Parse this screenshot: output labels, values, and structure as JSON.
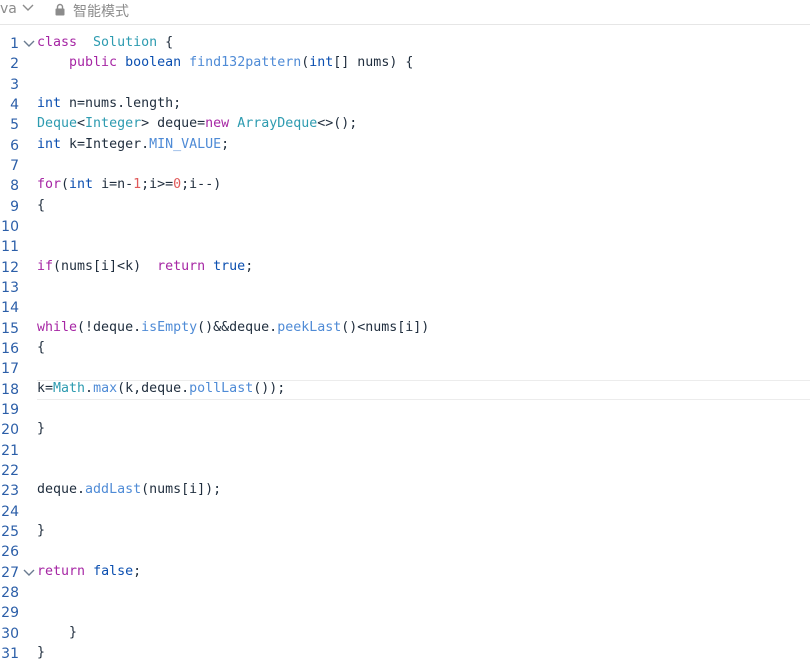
{
  "header": {
    "language": "va",
    "mode_label": "智能模式",
    "icons": [
      "chevron-down-icon",
      "lock-icon"
    ]
  },
  "editor": {
    "active_line": 18,
    "folded_lines": [
      1,
      27
    ],
    "lines": [
      {
        "n": "1",
        "tokens": [
          [
            "kw",
            "class"
          ],
          [
            "",
            "  "
          ],
          [
            "cls",
            "Solution"
          ],
          [
            "",
            " {"
          ]
        ]
      },
      {
        "n": "2",
        "tokens": [
          [
            "",
            "    "
          ],
          [
            "kw",
            "public"
          ],
          [
            "",
            " "
          ],
          [
            "ty",
            "boolean"
          ],
          [
            "",
            " "
          ],
          [
            "fn",
            "find132pattern"
          ],
          [
            "",
            "("
          ],
          [
            "ty",
            "int"
          ],
          [
            "",
            "[] nums) {"
          ]
        ]
      },
      {
        "n": "3",
        "tokens": []
      },
      {
        "n": "4",
        "tokens": [
          [
            "ty",
            "int"
          ],
          [
            "",
            " n=nums.length;"
          ]
        ]
      },
      {
        "n": "5",
        "tokens": [
          [
            "cls",
            "Deque"
          ],
          [
            "",
            "<"
          ],
          [
            "cls",
            "Integer"
          ],
          [
            "",
            "> deque="
          ],
          [
            "kw",
            "new"
          ],
          [
            "",
            " "
          ],
          [
            "cls",
            "ArrayDeque"
          ],
          [
            "",
            "<>();"
          ]
        ]
      },
      {
        "n": "6",
        "tokens": [
          [
            "ty",
            "int"
          ],
          [
            "",
            " k=Integer."
          ],
          [
            "fn",
            "MIN_VALUE"
          ],
          [
            "",
            ";"
          ]
        ]
      },
      {
        "n": "7",
        "tokens": []
      },
      {
        "n": "8",
        "tokens": [
          [
            "kw",
            "for"
          ],
          [
            "",
            "("
          ],
          [
            "ty",
            "int"
          ],
          [
            "",
            " i=n-"
          ],
          [
            "num",
            "1"
          ],
          [
            "",
            ";i>="
          ],
          [
            "num",
            "0"
          ],
          [
            "",
            ";i--)"
          ]
        ]
      },
      {
        "n": "9",
        "tokens": [
          [
            "",
            "{"
          ]
        ]
      },
      {
        "n": "10",
        "tokens": []
      },
      {
        "n": "11",
        "tokens": []
      },
      {
        "n": "12",
        "tokens": [
          [
            "kw",
            "if"
          ],
          [
            "",
            "(nums[i]<k)  "
          ],
          [
            "kw",
            "return"
          ],
          [
            "",
            " "
          ],
          [
            "ty",
            "true"
          ],
          [
            "",
            ";"
          ]
        ]
      },
      {
        "n": "13",
        "tokens": []
      },
      {
        "n": "14",
        "tokens": []
      },
      {
        "n": "15",
        "tokens": [
          [
            "kw",
            "while"
          ],
          [
            "",
            "(!deque."
          ],
          [
            "fn",
            "isEmpty"
          ],
          [
            "",
            "()&&deque."
          ],
          [
            "fn",
            "peekLast"
          ],
          [
            "",
            "()<nums[i])"
          ]
        ]
      },
      {
        "n": "16",
        "tokens": [
          [
            "",
            "{"
          ]
        ]
      },
      {
        "n": "17",
        "tokens": []
      },
      {
        "n": "18",
        "tokens": [
          [
            "",
            "k="
          ],
          [
            "cls",
            "Math"
          ],
          [
            "",
            "."
          ],
          [
            "fn",
            "max"
          ],
          [
            "",
            "(k,deque."
          ],
          [
            "fn",
            "pollLast"
          ],
          [
            "",
            "());"
          ]
        ]
      },
      {
        "n": "19",
        "tokens": []
      },
      {
        "n": "20",
        "tokens": [
          [
            "",
            "}"
          ]
        ]
      },
      {
        "n": "21",
        "tokens": []
      },
      {
        "n": "22",
        "tokens": []
      },
      {
        "n": "23",
        "tokens": [
          [
            "",
            "deque."
          ],
          [
            "fn",
            "addLast"
          ],
          [
            "",
            "(nums[i]);"
          ]
        ]
      },
      {
        "n": "24",
        "tokens": []
      },
      {
        "n": "25",
        "tokens": [
          [
            "",
            "}"
          ]
        ]
      },
      {
        "n": "26",
        "tokens": []
      },
      {
        "n": "27",
        "tokens": [
          [
            "kw",
            "return"
          ],
          [
            "",
            " "
          ],
          [
            "ty",
            "false"
          ],
          [
            "",
            ";"
          ]
        ]
      },
      {
        "n": "28",
        "tokens": []
      },
      {
        "n": "29",
        "tokens": []
      },
      {
        "n": "30",
        "tokens": [
          [
            "",
            "    }"
          ]
        ]
      },
      {
        "n": "31",
        "tokens": [
          [
            "",
            "}"
          ]
        ]
      }
    ]
  }
}
